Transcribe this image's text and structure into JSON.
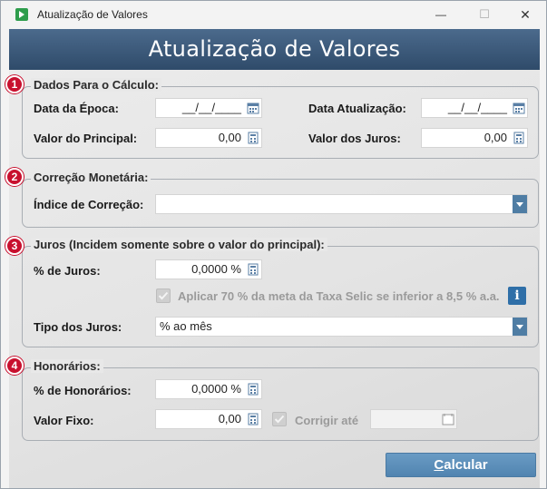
{
  "window": {
    "title": "Atualização de Valores",
    "min_glyph": "—",
    "max_glyph": "☐",
    "close_glyph": "✕"
  },
  "header": {
    "title": "Atualização de Valores"
  },
  "sections": {
    "dados": {
      "number": "1",
      "legend": "Dados Para o Cálculo:",
      "data_epoca_label": "Data da Época:",
      "data_epoca_value": "__/__/____",
      "data_atualizacao_label": "Data Atualização:",
      "data_atualizacao_value": "__/__/____",
      "valor_principal_label": "Valor do Principal:",
      "valor_principal_value": "0,00",
      "valor_juros_label": "Valor dos Juros:",
      "valor_juros_value": "0,00"
    },
    "correcao": {
      "number": "2",
      "legend": "Correção Monetária:",
      "indice_label": "Índice de Correção:",
      "indice_value": ""
    },
    "juros": {
      "number": "3",
      "legend": "Juros  (Incidem somente sobre o valor do principal):",
      "percent_label": "% de Juros:",
      "percent_value": "0,0000 %",
      "selic_label": "Aplicar 70 % da meta da Taxa Selic se inferior a 8,5 % a.a.",
      "selic_checked": true,
      "info_glyph": "i",
      "tipo_label": "Tipo dos Juros:",
      "tipo_value": "% ao mês"
    },
    "honorarios": {
      "number": "4",
      "legend": "Honorários:",
      "percent_label": "% de Honorários:",
      "percent_value": "0,0000 %",
      "valor_fixo_label": "Valor Fixo:",
      "valor_fixo_value": "0,00",
      "corrigir_label": "Corrigir até",
      "corrigir_checked": true,
      "corrigir_value": ""
    }
  },
  "actions": {
    "calc_label_first": "C",
    "calc_label_rest": "alcular"
  },
  "colors": {
    "header_bg": "#3a5878",
    "badge": "#c8102e",
    "button": "#5a8ab5",
    "dropdown_arrow": "#4f7da4"
  }
}
